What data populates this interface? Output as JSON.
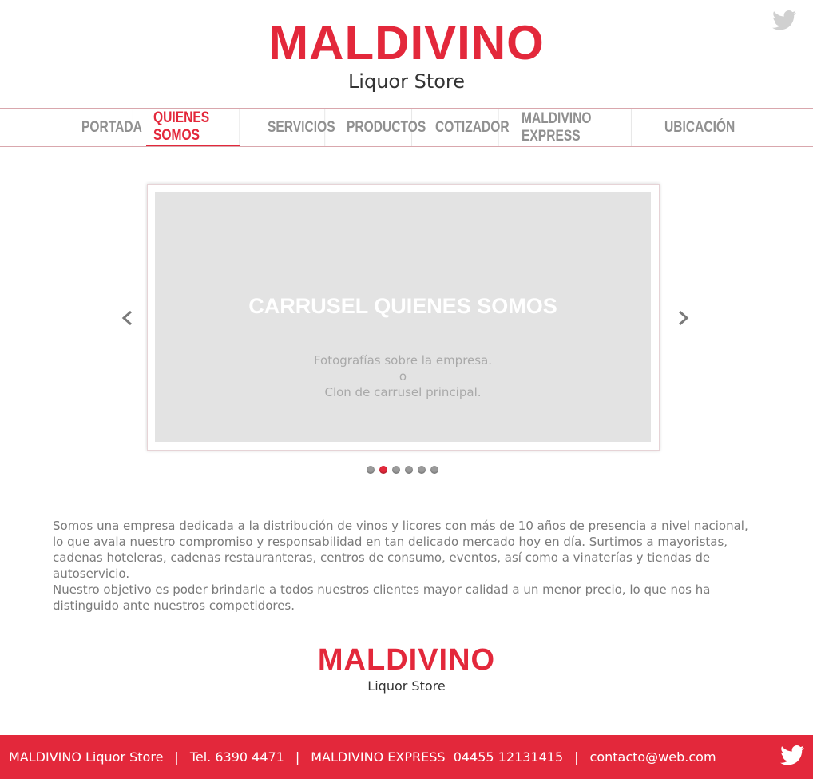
{
  "header": {
    "logo_word": "MALDIVINO",
    "logo_sub": "Liquor Store",
    "twitter_icon": "twitter-bird-icon"
  },
  "nav": {
    "items": [
      {
        "label": "PORTADA",
        "active": false
      },
      {
        "label": "QUIENES SOMOS",
        "active": true
      },
      {
        "label": "SERVICIOS",
        "active": false
      },
      {
        "label": "PRODUCTOS",
        "active": false
      },
      {
        "label": "COTIZADOR",
        "active": false
      },
      {
        "label": "MALDIVINO EXPRESS",
        "active": false
      },
      {
        "label": "UBICACIÓN",
        "active": false
      }
    ]
  },
  "carousel": {
    "title": "CARRUSEL QUIENES SOMOS",
    "line1": "Fotografías sobre la empresa.",
    "line2": "o",
    "line3": "Clon de carrusel principal.",
    "prev_icon": "chevron-left-icon",
    "next_icon": "chevron-right-icon",
    "dot_count": 6,
    "active_dot": 2
  },
  "about": {
    "p1_l1": "Somos una empresa dedicada a la distribución de vinos y licores con más de 10 años de presencia a nivel nacional,",
    "p1_l2": "lo que avala nuestro compromiso y responsabilidad en tan delicado mercado hoy en día. Surtimos a mayoristas,",
    "p1_l3": "cadenas hoteleras, cadenas restauranteras, centros de consumo, eventos, así como a vinaterías y tiendas de autoservicio.",
    "p2": "Nuestro objetivo es poder brindarle a todos nuestros clientes mayor calidad a un menor precio, lo que nos ha distinguido ante nuestros competidores."
  },
  "footer": {
    "store": "MALDIVINO Liquor Store",
    "separator": "|",
    "tel": "Tel. 6390 4471",
    "express": "MALDIVINO EXPRESS  04455 12131415",
    "email": "contacto@web.com",
    "twitter_icon": "twitter-bird-icon"
  },
  "colors": {
    "brand_red": "#e3283b",
    "nav_gray": "#909090",
    "slide_bg": "#e3e3e3"
  }
}
